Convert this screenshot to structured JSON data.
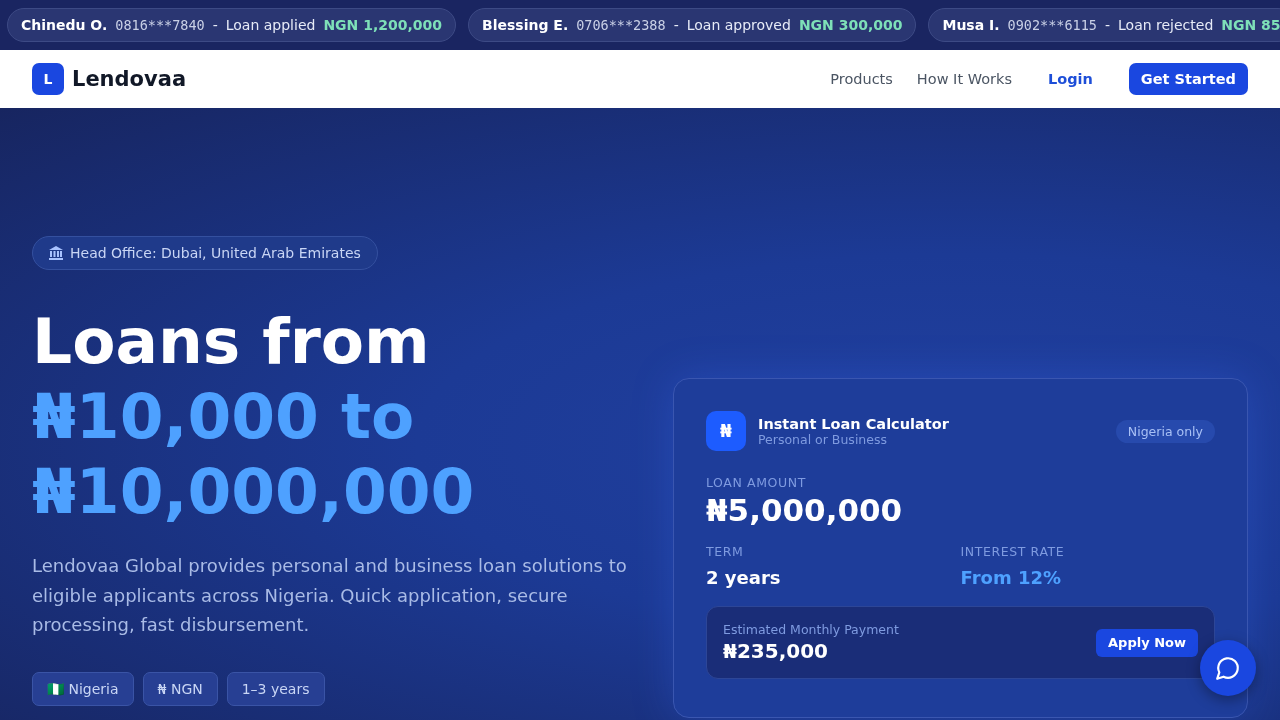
{
  "ticker": [
    {
      "name": "Chinedu O.",
      "phone": "0816***7840",
      "separator": "-",
      "status": "Loan applied",
      "amount": "NGN 1,200,000"
    },
    {
      "name": "Blessing E.",
      "phone": "0706***2388",
      "separator": "-",
      "status": "Loan approved",
      "amount": "NGN 300,000"
    },
    {
      "name": "Musa I.",
      "phone": "0902***6115",
      "separator": "-",
      "status": "Loan rejected",
      "amount": "NGN 85"
    }
  ],
  "navbar": {
    "logo_letter": "L",
    "brand": "Lendovaa",
    "links": [
      "Products",
      "How It Works"
    ],
    "login": "Login",
    "cta": "Get Started"
  },
  "hero": {
    "badge": "Head Office: Dubai, United Arab Emirates",
    "headline": [
      "Loans from",
      "₦10,000 to",
      "₦10,000,000"
    ],
    "description": "Lendovaa Global provides personal and business loan solutions to eligible applicants across Nigeria. Quick application, secure processing, fast disbursement.",
    "chips": [
      "🇳🇬 Nigeria",
      "₦ NGN",
      "1–3 years"
    ]
  },
  "calculator": {
    "icon": "₦",
    "title": "Instant Loan Calculator",
    "subtitle": "Personal or Business",
    "badge": "Nigeria only",
    "amount_label": "LOAN AMOUNT",
    "amount": "₦5,000,000",
    "term_label": "TERM",
    "term": "2 years",
    "rate_label": "INTEREST RATE",
    "rate": "From 12%",
    "payment_label": "Estimated Monthly Payment",
    "payment": "₦235,000",
    "apply": "Apply Now"
  }
}
